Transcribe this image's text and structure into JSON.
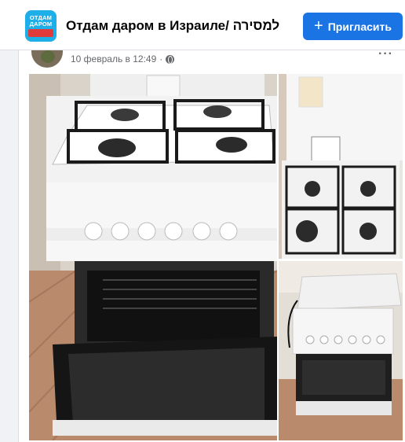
{
  "header": {
    "logo": {
      "line1": "ОТДАМ",
      "line2": "ДАРОМ",
      "accent_color": "#1eaee8"
    },
    "group_name": "Отдам даром в Израиле/ למסירה",
    "invite_button": {
      "icon": "plus-icon",
      "label": "Пригласить",
      "color": "#1b74e4"
    }
  },
  "post": {
    "timestamp": "10 февраль в 12:49",
    "privacy_icon": "globe-icon",
    "more_icon": "ellipsis-icon",
    "photos": [
      {
        "subject": "white gas stove with open oven door, lid raised"
      },
      {
        "subject": "top view of 4-burner gas hob with manual"
      },
      {
        "subject": "stove with closed lid and oven drawer"
      }
    ]
  }
}
